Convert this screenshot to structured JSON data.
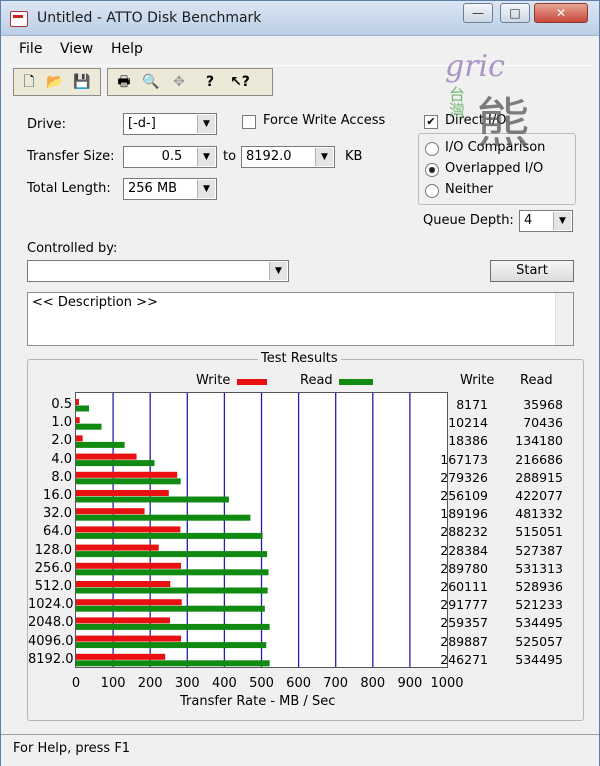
{
  "window": {
    "title": "Untitled - ATTO Disk Benchmark",
    "min_label": "—",
    "max_label": "□",
    "close_label": "✕"
  },
  "menu": [
    "File",
    "View",
    "Help"
  ],
  "toolbar_icons": [
    "new-icon",
    "open-icon",
    "save-icon",
    "print-icon",
    "print-preview-icon",
    "move-icon",
    "help-icon",
    "context-help-icon"
  ],
  "settings": {
    "drive_label": "Drive:",
    "drive_value": "[-d-]",
    "force_write_label": "Force Write Access",
    "direct_io_label": "Direct I/O",
    "direct_io_checked": "✔",
    "transfer_size_label": "Transfer Size:",
    "transfer_from": "0.5",
    "to_label": "to",
    "transfer_to": "8192.0",
    "kb_label": "KB",
    "total_length_label": "Total Length:",
    "total_length_value": "256 MB",
    "io_comparison_label": "I/O Comparison",
    "overlapped_label": "Overlapped I/O",
    "neither_label": "Neither",
    "queue_depth_label": "Queue Depth:",
    "queue_depth_value": "4",
    "controlled_by_label": "Controlled by:",
    "controlled_by_value": "",
    "start_label": "Start",
    "description_text": "<< Description >>"
  },
  "results": {
    "title": "Test Results",
    "write_legend": "Write",
    "read_legend": "Read",
    "write_col": "Write",
    "read_col": "Read",
    "xlabel": "Transfer Rate - MB / Sec",
    "xticks": [
      "0",
      "100",
      "200",
      "300",
      "400",
      "500",
      "600",
      "700",
      "800",
      "900",
      "1000"
    ]
  },
  "chart_data": {
    "type": "bar",
    "orientation": "horizontal",
    "xlabel": "Transfer Rate - MB / Sec",
    "xlim": [
      0,
      1000
    ],
    "categories": [
      "0.5",
      "1.0",
      "2.0",
      "4.0",
      "8.0",
      "16.0",
      "32.0",
      "64.0",
      "128.0",
      "256.0",
      "512.0",
      "1024.0",
      "2048.0",
      "4096.0",
      "8192.0"
    ],
    "series": [
      {
        "name": "Write",
        "color": "#e81010",
        "values": [
          8171,
          10214,
          18386,
          167173,
          279326,
          256109,
          189196,
          288232,
          228384,
          289780,
          260111,
          291777,
          259357,
          289887,
          246271
        ]
      },
      {
        "name": "Read",
        "color": "#108a10",
        "values": [
          35968,
          70436,
          134180,
          216686,
          288915,
          422077,
          481332,
          515051,
          527387,
          531313,
          528936,
          521233,
          534495,
          525057,
          534495
        ]
      }
    ],
    "value_unit_in_table": "KB/s"
  },
  "watermark": {
    "line1": "gric",
    "line2": "台灣",
    "line3": "熊"
  },
  "status": {
    "text": "For Help, press F1"
  }
}
